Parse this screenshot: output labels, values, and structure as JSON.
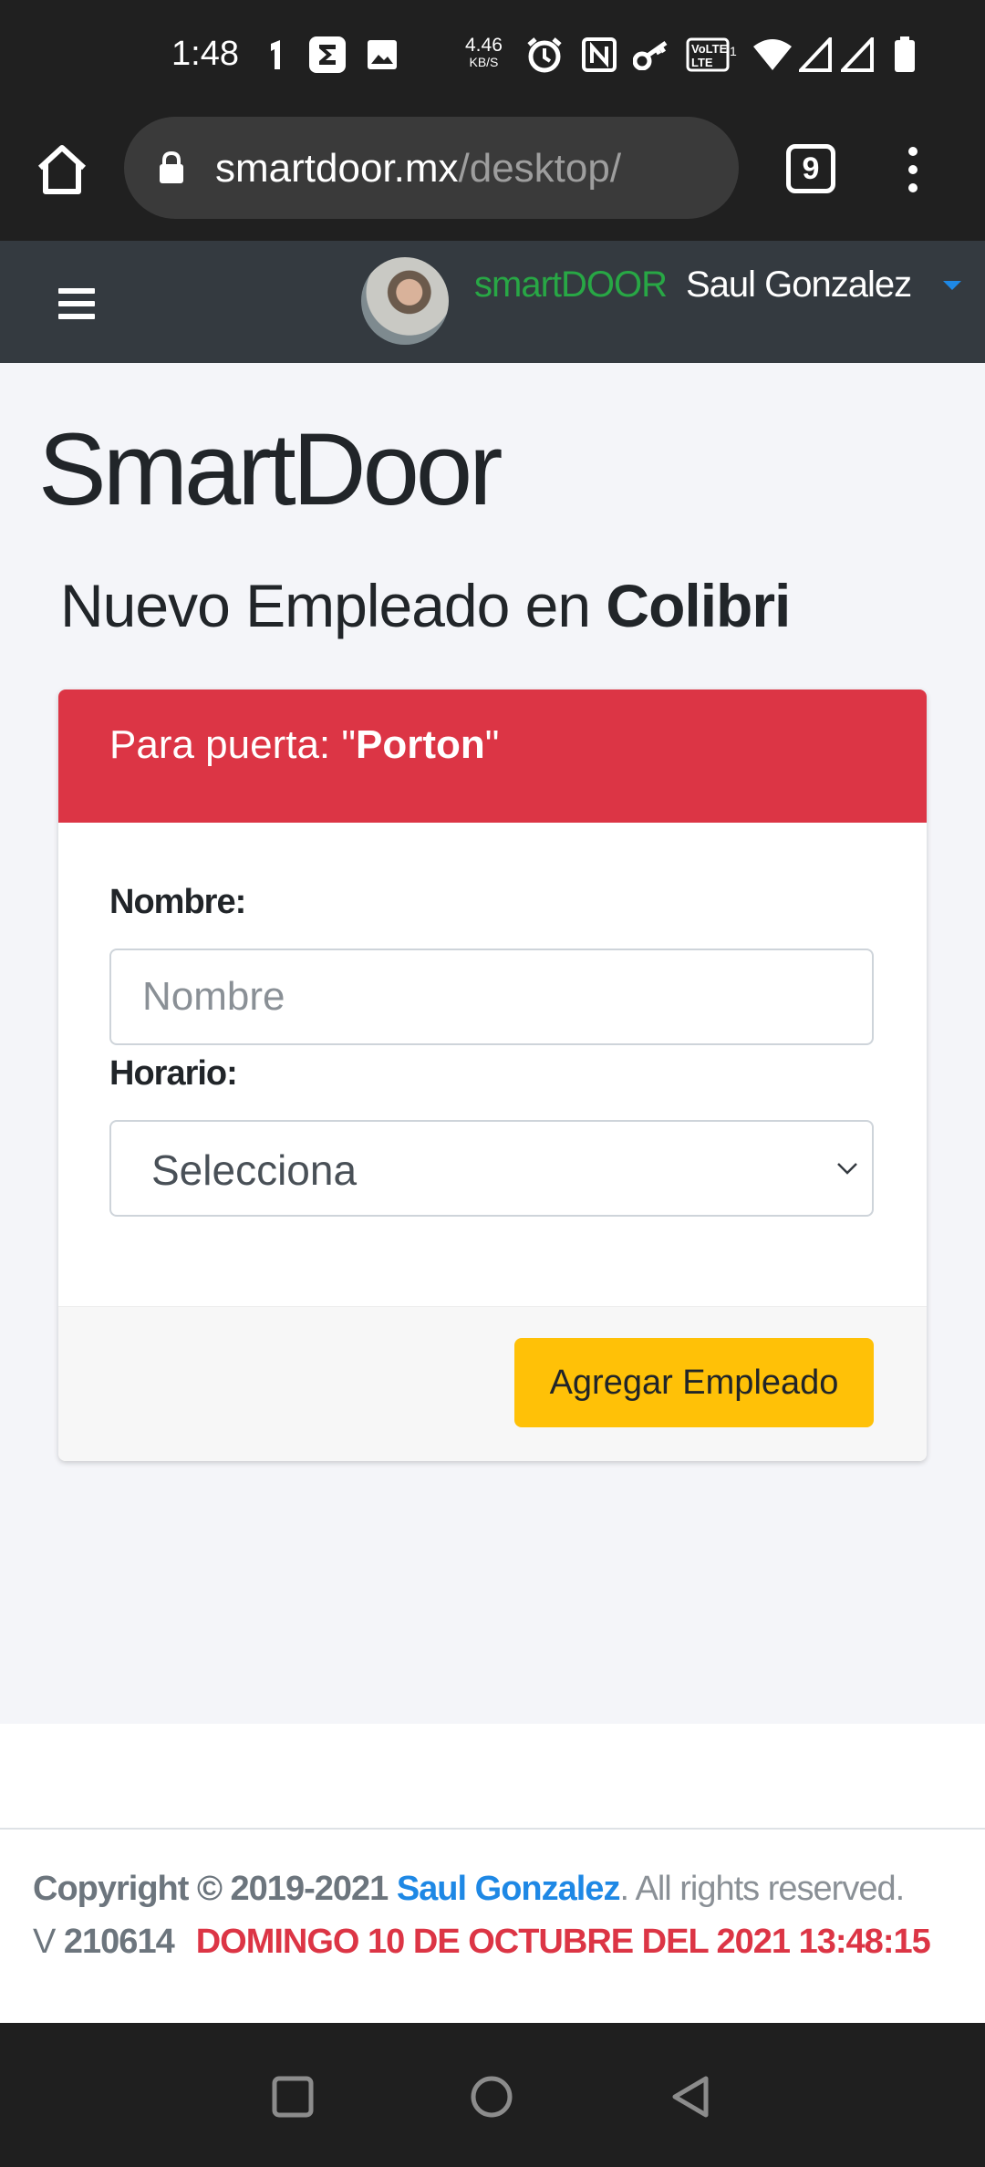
{
  "status_bar": {
    "time": "1:48",
    "net_speed_value": "4.46",
    "net_speed_unit": "KB/S",
    "icons": [
      "notification-icon",
      "sigma-app-icon",
      "gallery-icon",
      "alarm-icon",
      "nfc-icon",
      "key-icon",
      "volte-icon",
      "wifi-icon",
      "signal-icon",
      "signal-icon-2",
      "battery-icon"
    ]
  },
  "browser": {
    "url_domain": "smartdoor.mx",
    "url_path": "/desktop/",
    "tab_count": "9"
  },
  "navbar": {
    "brand": "smartDOOR",
    "user_name": "Saul Gonzalez"
  },
  "page": {
    "title": "SmartDoor",
    "subtitle_prefix": "Nuevo Empleado en ",
    "subtitle_company": "Colibri"
  },
  "card": {
    "header_prefix": "Para puerta: \"",
    "header_door": "Porton",
    "header_suffix": "\"",
    "name_label": "Nombre:",
    "name_placeholder": "Nombre",
    "schedule_label": "Horario:",
    "schedule_selected": "Selecciona",
    "submit_label": "Agregar Empleado"
  },
  "footer": {
    "copyright_prefix": "Copyright © 2019-2021 ",
    "author": "Saul Gonzalez",
    "rights": ". All rights reserved.",
    "version_prefix": "V ",
    "version_number": "210614",
    "datetime": "DOMINGO 10 DE OCTUBRE DEL 2021 13:48:15"
  },
  "colors": {
    "navbar_bg": "#343a40",
    "brand_green": "#28a745",
    "header_red": "#dc3545",
    "button_yellow": "#ffc107",
    "link_blue": "#1e88e5"
  }
}
